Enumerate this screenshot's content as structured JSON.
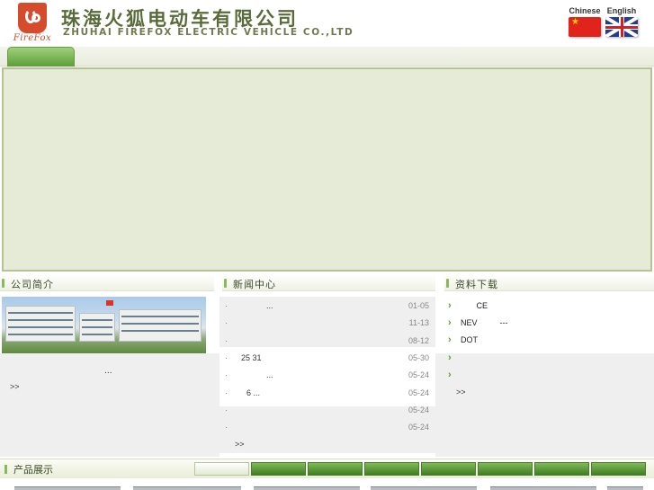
{
  "header": {
    "company_cn": "珠海火狐电动车有限公司",
    "company_en": "ZHUHAI FIREFOX ELECTRIC VEHICLE CO.,LTD",
    "logo_text": "FireFox",
    "languages": [
      {
        "label": "Chinese",
        "flag": "china-flag-icon"
      },
      {
        "label": "English",
        "flag": "uk-flag-icon"
      }
    ]
  },
  "sections": {
    "about": {
      "title": "公司简介",
      "text": "...",
      "more": ">>"
    },
    "news": {
      "title": "新闻中心",
      "more": ">>"
    },
    "downloads": {
      "title": "资料下载",
      "more": ">>"
    },
    "products": {
      "title": "产品展示"
    }
  },
  "news": [
    {
      "text": "...",
      "date": "01-05"
    },
    {
      "text": "",
      "date": "11-13"
    },
    {
      "text": "",
      "date": "08-12"
    },
    {
      "text": "25  31",
      "date": "05-30"
    },
    {
      "text": "...",
      "date": "05-24"
    },
    {
      "text": "6        ...",
      "date": "05-24"
    },
    {
      "text": "",
      "date": "05-24"
    },
    {
      "text": "",
      "date": "05-24"
    }
  ],
  "downloads": [
    {
      "text": "       CE"
    },
    {
      "text": "NEV          ---"
    },
    {
      "text": "DOT"
    },
    {
      "text": ""
    },
    {
      "text": ""
    }
  ],
  "colors": {
    "accent_green": "#5fa03a",
    "banner_bg": "#e6ebd7",
    "title_text": "#5a6b3a"
  }
}
